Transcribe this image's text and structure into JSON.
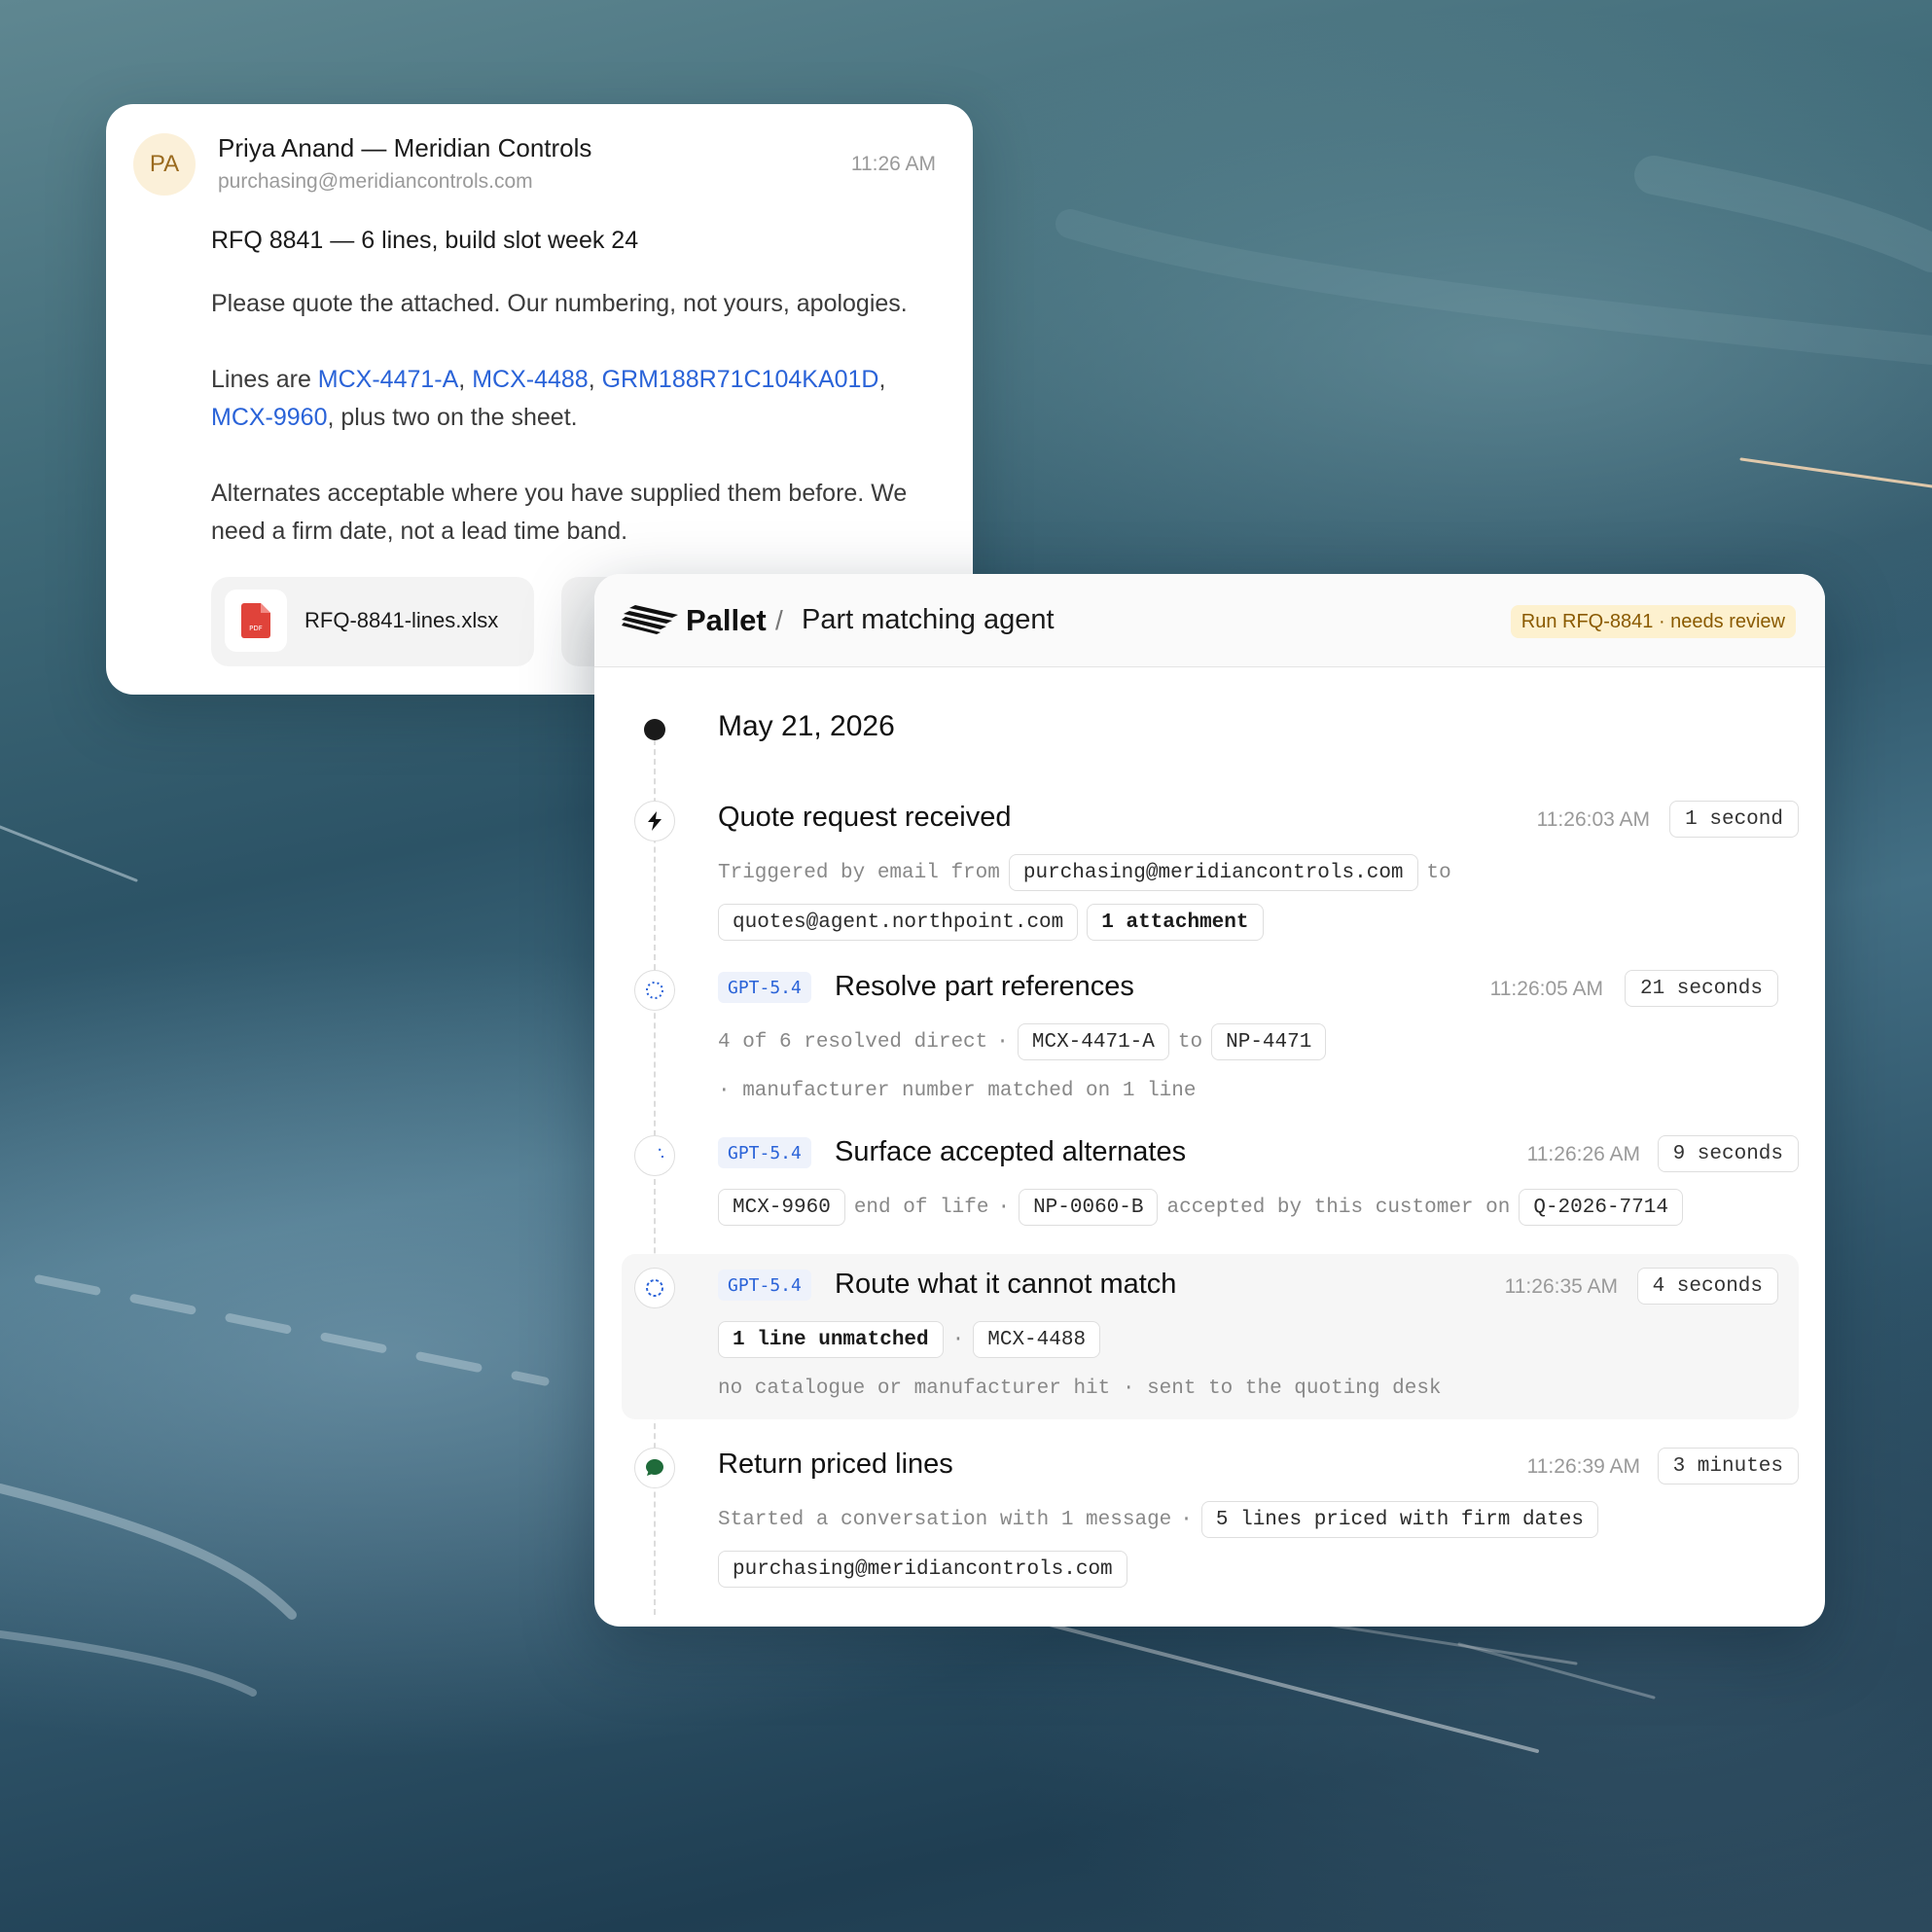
{
  "email": {
    "avatar_initials": "PA",
    "sender_name": "Priya Anand — Meridian Controls",
    "sender_email": "purchasing@meridiancontrols.com",
    "time": "11:26 AM",
    "subject": "RFQ 8841 — 6 lines, build slot week 24",
    "para1": "Please quote the attached. Our numbering, not yours, apologies.",
    "para2_prefix": "Lines are ",
    "part_links": [
      "MCX-4471-A",
      "MCX-4488",
      "GRM188R71C104KA01D",
      "MCX-9960"
    ],
    "para2_suffix": ", plus two on the sheet.",
    "para3": "Alternates acceptable where you have supplied them before. We need a firm date, not a lead time band.",
    "attachment_name": "RFQ-8841-lines.xlsx",
    "attachment_icon": "pdf-file-icon",
    "attachment_icon_label": "PDF"
  },
  "panel": {
    "brand": "Pallet",
    "separator": "/",
    "title": "Part matching agent",
    "run_badge": "Run RFQ-8841 · needs review",
    "date": "May 21, 2026",
    "steps": [
      {
        "title": "Quote request received",
        "icon": "lightning-icon",
        "time": "11:26:03 AM",
        "duration": "1 second",
        "detail_text1": "Triggered by email from",
        "chip1": "purchasing@meridiancontrols.com",
        "detail_text2": "to",
        "chip2": "quotes@agent.northpoint.com",
        "chip3": "1 attachment"
      },
      {
        "model": "GPT-5.4",
        "title": "Resolve part references",
        "icon": "spinner-icon",
        "time": "11:26:05 AM",
        "duration": "21 seconds",
        "detail_text1": "4 of 6 resolved direct",
        "dot": "·",
        "chip1": "MCX-4471-A",
        "detail_text2": "to",
        "chip2": "NP-4471",
        "detail_text3": "· manufacturer number matched on 1 line"
      },
      {
        "model": "GPT-5.4",
        "title": "Surface accepted alternates",
        "icon": "spinner-icon",
        "time": "11:26:26 AM",
        "duration": "9 seconds",
        "chip1": "MCX-9960",
        "detail_text1": "end of life",
        "dot": "·",
        "chip2": "NP-0060-B",
        "detail_text2": "accepted by this customer on",
        "chip3": "Q-2026-7714"
      },
      {
        "model": "GPT-5.4",
        "title": "Route what it cannot match",
        "icon": "spinner-icon",
        "time": "11:26:35 AM",
        "duration": "4 seconds",
        "chip1": "1 line unmatched",
        "dot": "·",
        "chip2": "MCX-4488",
        "detail_text1": "no catalogue or manufacturer hit · sent to the quoting desk"
      },
      {
        "title": "Return priced lines",
        "icon": "chat-bubble-icon",
        "time": "11:26:39 AM",
        "duration": "3 minutes",
        "detail_text1": "Started a conversation with 1 message",
        "dot": "·",
        "chip1": "5 lines priced with firm dates",
        "chip2": "purchasing@meridiancontrols.com"
      }
    ]
  },
  "colors": {
    "link": "#2a63d8",
    "badge_bg": "#fdf1cf",
    "badge_text": "#8a5a00",
    "success": "#1f6b3a",
    "pdf_red": "#e0433a"
  }
}
